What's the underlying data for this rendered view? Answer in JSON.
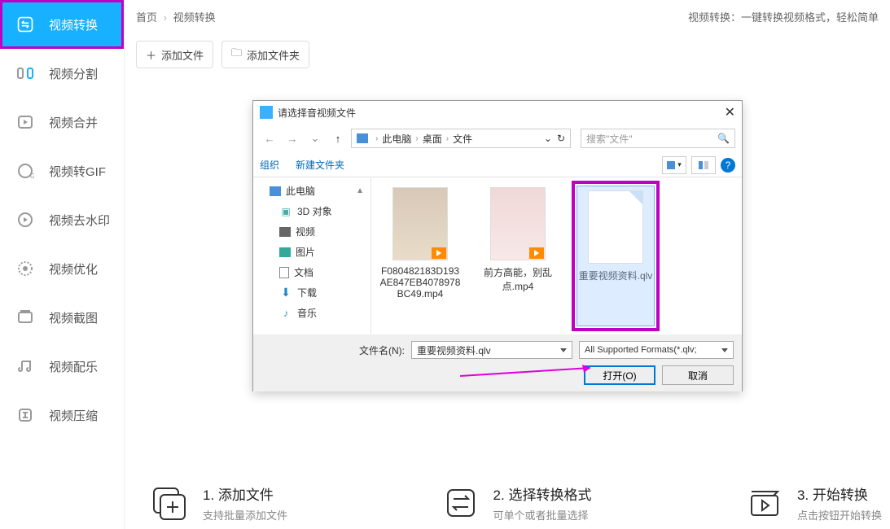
{
  "sidebar": {
    "items": [
      {
        "label": "视频转换"
      },
      {
        "label": "视频分割"
      },
      {
        "label": "视频合并"
      },
      {
        "label": "视频转GIF"
      },
      {
        "label": "视频去水印"
      },
      {
        "label": "视频优化"
      },
      {
        "label": "视频截图"
      },
      {
        "label": "视频配乐"
      },
      {
        "label": "视频压缩"
      }
    ]
  },
  "breadcrumb": {
    "home": "首页",
    "current": "视频转换",
    "tagline": "视频转换：一键转换视频格式，轻松简单"
  },
  "toolbar": {
    "add_file": "添加文件",
    "add_folder": "添加文件夹"
  },
  "steps": [
    {
      "title": "1. 添加文件",
      "desc": "支持批量添加文件"
    },
    {
      "title": "2. 选择转换格式",
      "desc": "可单个或者批量选择"
    },
    {
      "title": "3. 开始转换",
      "desc": "点击按钮开始转换"
    }
  ],
  "dialog": {
    "title": "请选择音视频文件",
    "nav": {
      "seg1": "此电脑",
      "seg2": "桌面",
      "seg3": "文件"
    },
    "search_placeholder": "搜索\"文件\"",
    "organize": "组织",
    "new_folder": "新建文件夹",
    "tree": {
      "root": "此电脑",
      "items": [
        {
          "label": "3D 对象"
        },
        {
          "label": "视频"
        },
        {
          "label": "图片"
        },
        {
          "label": "文档"
        },
        {
          "label": "下载"
        },
        {
          "label": "音乐"
        }
      ]
    },
    "files": [
      {
        "name": "F080482183D193AE847EB4078978BC49.mp4"
      },
      {
        "name": "前方高能，别乱点.mp4"
      },
      {
        "name": "重要视频资料.qlv"
      }
    ],
    "filename_label": "文件名(N):",
    "filename_value": "重要视频资料.qlv",
    "format_filter": "All Supported Formats(*.qlv;",
    "open": "打开(O)",
    "cancel": "取消"
  }
}
